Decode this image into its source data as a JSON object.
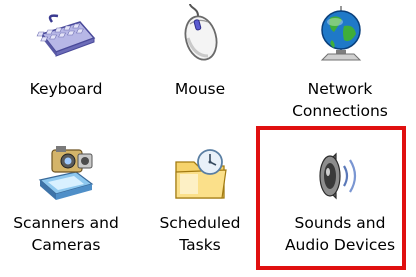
{
  "window": {
    "items": [
      {
        "label": "Keyboard",
        "icon": "keyboard-icon"
      },
      {
        "label": "Mouse",
        "icon": "mouse-icon"
      },
      {
        "label": "Network\nConnections",
        "icon": "network-globe-icon"
      },
      {
        "label": "Scanners and\nCameras",
        "icon": "scanner-camera-icon"
      },
      {
        "label": "Scheduled\nTasks",
        "icon": "scheduled-tasks-folder-icon"
      },
      {
        "label": "Sounds and\nAudio Devices",
        "icon": "speaker-icon"
      }
    ]
  },
  "colors": {
    "highlight": "#e01010",
    "background": "#ffffff"
  }
}
